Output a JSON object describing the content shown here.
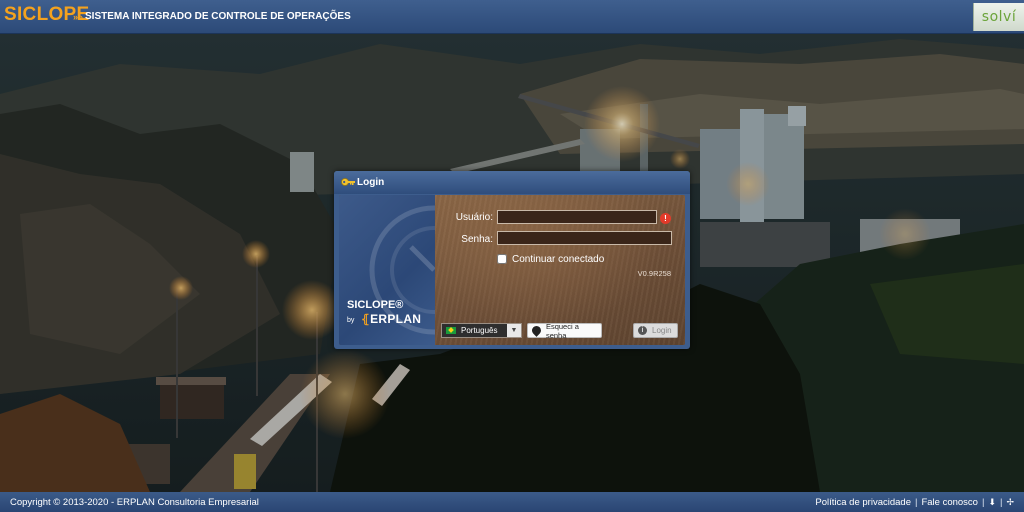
{
  "header": {
    "brand": "SICLOPE",
    "separator": "»»",
    "system_name": "SISTEMA INTEGRADO DE CONTROLE DE OPERAÇÕES",
    "partner_logo": "solví"
  },
  "login": {
    "title": "Login",
    "icon": "key-icon",
    "panel": {
      "product": "SICLOPE®",
      "by": "by",
      "company": "ERPLAN"
    },
    "username_label": "Usuário:",
    "username_value": "",
    "password_label": "Senha:",
    "password_value": "",
    "remember_label": "Continuar conectado",
    "remember_checked": false,
    "version": "V0.9R258",
    "language": "Português",
    "forgot_label": "Esqueci a senha",
    "login_button": "Login"
  },
  "footer": {
    "copyright": "Copyright © 2013-2020 - ERPLAN Consultoria Empresarial",
    "privacy": "Política de privacidade",
    "separator": "|",
    "contact": "Fale conosco"
  },
  "colors": {
    "brand_orange": "#f4a21e",
    "header_blue": "#2c4a78",
    "warning_red": "#e23a2a"
  }
}
